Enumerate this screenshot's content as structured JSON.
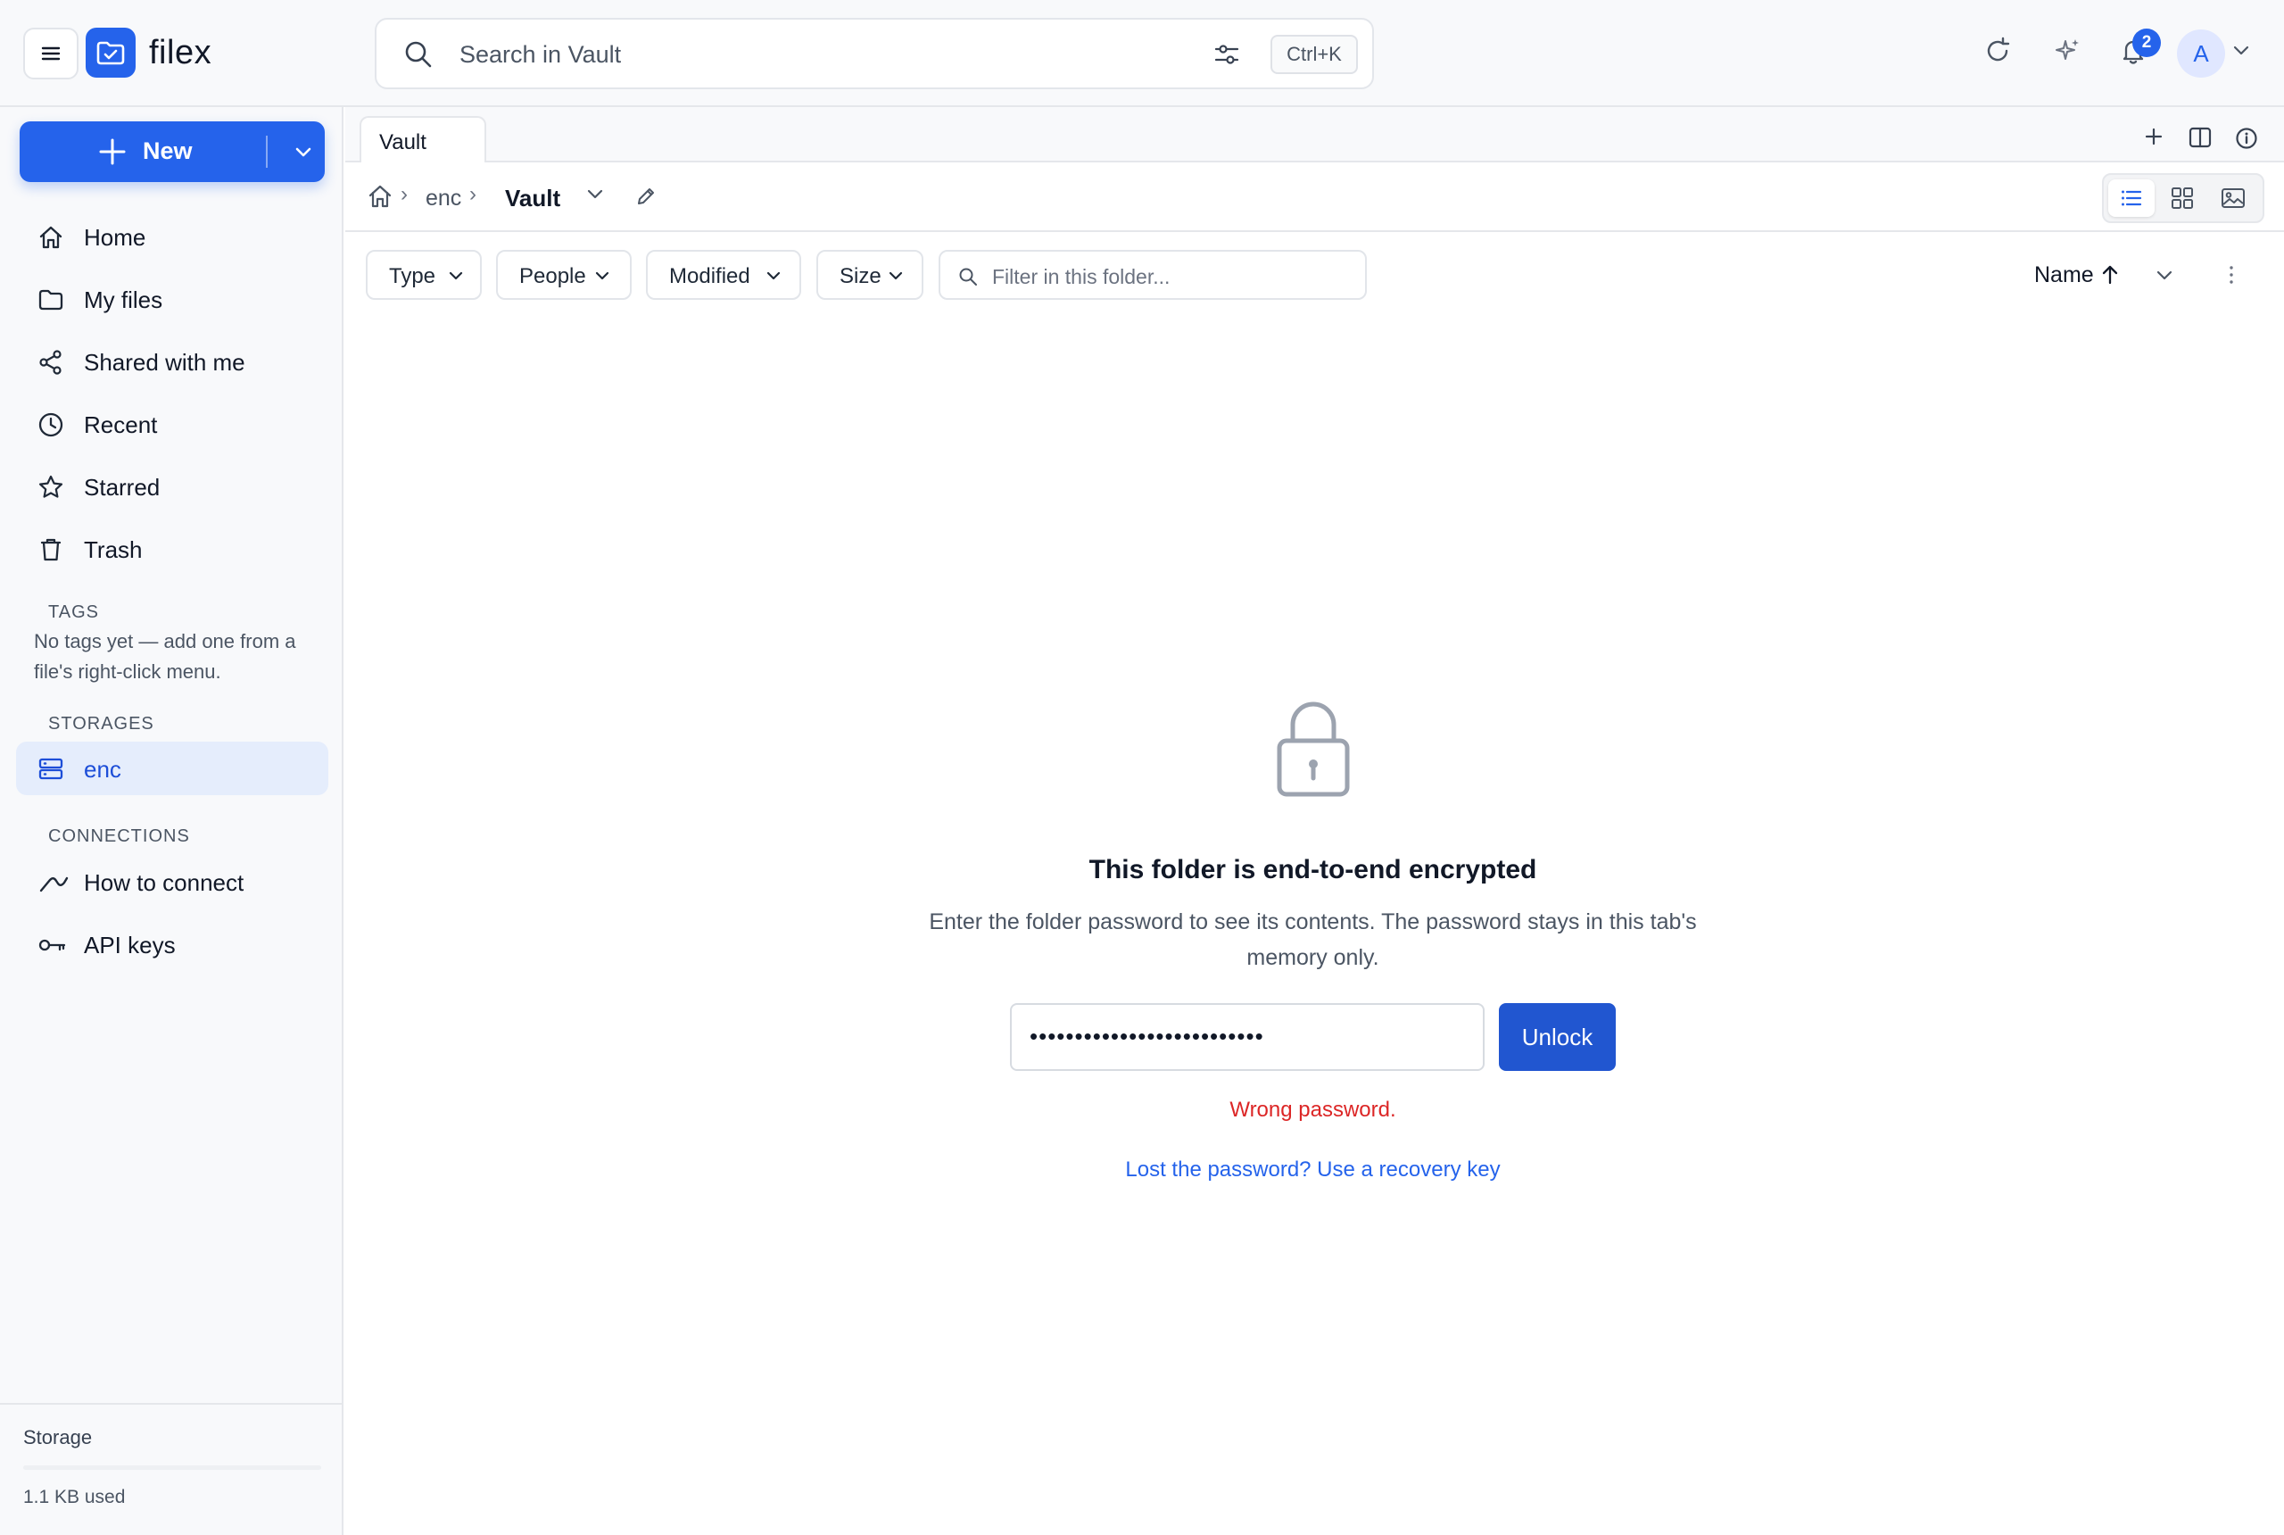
{
  "app": {
    "name": "filex"
  },
  "header": {
    "search_placeholder": "Search in Vault",
    "shortcut": "Ctrl+K",
    "notifications_count": "2",
    "avatar_initial": "A"
  },
  "sidebar": {
    "new_label": "New",
    "nav": [
      {
        "label": "Home",
        "icon": "home-icon"
      },
      {
        "label": "My files",
        "icon": "folder-icon"
      },
      {
        "label": "Shared with me",
        "icon": "share-icon"
      },
      {
        "label": "Recent",
        "icon": "clock-icon"
      },
      {
        "label": "Starred",
        "icon": "star-icon"
      },
      {
        "label": "Trash",
        "icon": "trash-icon"
      }
    ],
    "tags_title": "TAGS",
    "tags_empty": "No tags yet — add one from a file's right-click menu.",
    "storages_title": "STORAGES",
    "storages": [
      {
        "label": "enc",
        "icon": "server-icon",
        "active": true
      }
    ],
    "connections_title": "CONNECTIONS",
    "connections": [
      {
        "label": "How to connect",
        "icon": "link-icon"
      },
      {
        "label": "API keys",
        "icon": "key-icon"
      }
    ],
    "storage": {
      "title": "Storage",
      "used": "1.1 KB used",
      "fraction": 0.0
    }
  },
  "tabs": [
    {
      "label": "Vault"
    }
  ],
  "breadcrumb": {
    "storage": "enc",
    "current": "Vault"
  },
  "filters": {
    "chips": [
      "Type",
      "People",
      "Modified",
      "Size"
    ],
    "placeholder": "Filter in this folder..."
  },
  "sort": {
    "label": "Name",
    "direction": "ascending"
  },
  "view_mode": "list",
  "locked": {
    "title": "This folder is end-to-end encrypted",
    "description": "Enter the folder password to see its contents. The password stays in this tab's memory only.",
    "password_value": "••••••••••••••••••••••••••",
    "unlock_label": "Unlock",
    "error": "Wrong password.",
    "recovery_link": "Lost the password? Use a recovery key"
  },
  "colors": {
    "accent": "#2563eb",
    "error": "#dc2626"
  }
}
